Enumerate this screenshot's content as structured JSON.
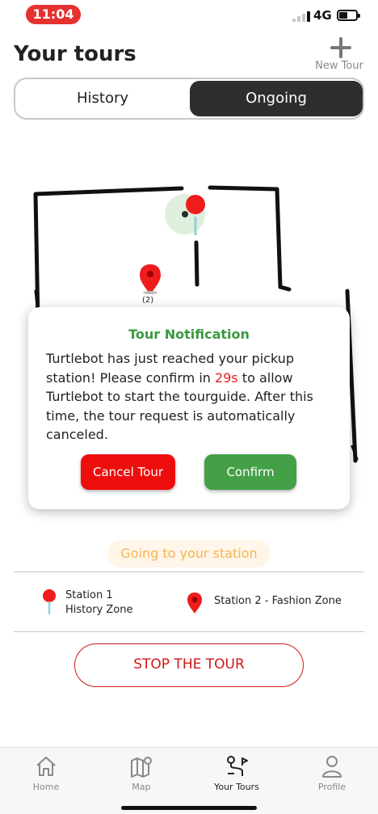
{
  "status_bar": {
    "time": "11:04",
    "network": "4G",
    "time_pill_color": "#e5322e",
    "icons": [
      "signal-icon",
      "battery-icon"
    ]
  },
  "header": {
    "title": "Your tours",
    "new_tour_label": "New Tour",
    "new_tour_icon": "plus-icon"
  },
  "tabs": [
    {
      "label": "History",
      "active": false
    },
    {
      "label": "Ongoing",
      "active": true
    }
  ],
  "map": {
    "marker_label": "(2)",
    "icons": [
      "robot-location-icon",
      "pin-icon"
    ]
  },
  "notification": {
    "title": "Tour Notification",
    "body_before": "Turtlebot has just reached your pickup station! Please confirm in ",
    "countdown": "29s",
    "body_after": " to allow Turtlebot to start the tourguide. After this time, the tour request is automatically canceled.",
    "cancel_label": "Cancel Tour",
    "confirm_label": "Confirm",
    "title_color": "#3a9a3f",
    "cancel_color": "#ee0d0d",
    "confirm_color": "#43a047"
  },
  "status_chip": {
    "text": "Going to your station",
    "color": "#f6b453"
  },
  "stations": [
    {
      "line1": "Station 1",
      "line2": "History Zone",
      "icon": "pin-icon"
    },
    {
      "label": "Station 2 - Fashion Zone",
      "icon": "pin-icon"
    }
  ],
  "stop_button": {
    "label": "STOP THE TOUR",
    "color": "#d01616"
  },
  "bottom_nav": [
    {
      "label": "Home",
      "icon": "home-icon",
      "active": false
    },
    {
      "label": "Map",
      "icon": "map-icon",
      "active": false
    },
    {
      "label": "Your Tours",
      "icon": "route-icon",
      "active": true
    },
    {
      "label": "Profile",
      "icon": "profile-icon",
      "active": false
    }
  ]
}
